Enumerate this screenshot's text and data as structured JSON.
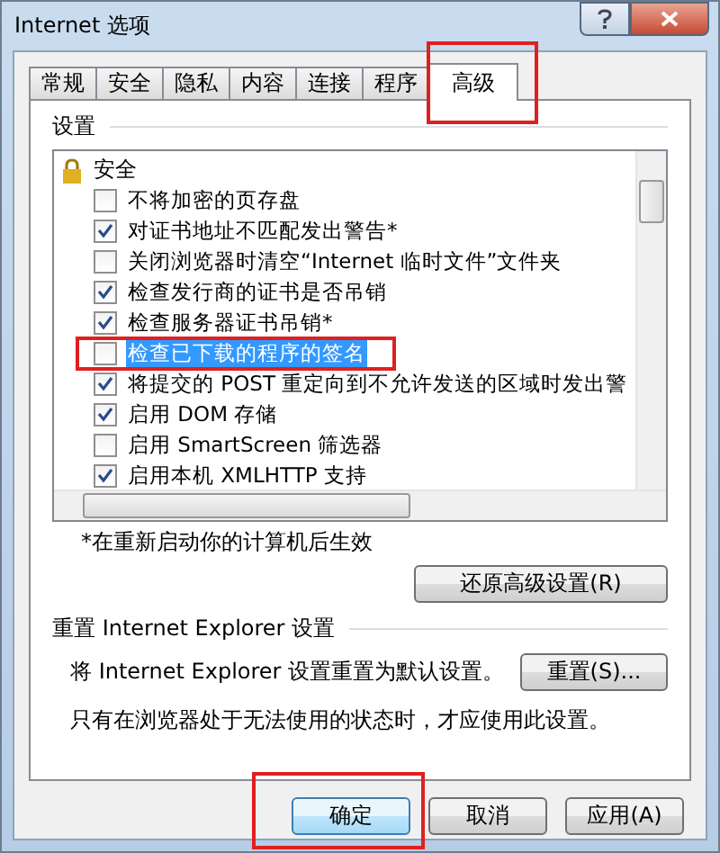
{
  "window": {
    "title": "Internet 选项"
  },
  "tabs": [
    {
      "label": "常规",
      "selected": false,
      "marked": false
    },
    {
      "label": "安全",
      "selected": false,
      "marked": false
    },
    {
      "label": "隐私",
      "selected": false,
      "marked": false
    },
    {
      "label": "内容",
      "selected": false,
      "marked": false
    },
    {
      "label": "连接",
      "selected": false,
      "marked": false
    },
    {
      "label": "程序",
      "selected": false,
      "marked": false
    },
    {
      "label": "高级",
      "selected": true,
      "marked": true
    }
  ],
  "settings": {
    "heading": "设置",
    "group": "安全",
    "items": [
      {
        "label": "不将加密的页存盘",
        "checked": false,
        "selected": false,
        "marked": false
      },
      {
        "label": "对证书地址不匹配发出警告*",
        "checked": true,
        "selected": false,
        "marked": false
      },
      {
        "label": "关闭浏览器时清空“Internet 临时文件”文件夹",
        "checked": false,
        "selected": false,
        "marked": false
      },
      {
        "label": "检查发行商的证书是否吊销",
        "checked": true,
        "selected": false,
        "marked": false
      },
      {
        "label": "检查服务器证书吊销*",
        "checked": true,
        "selected": false,
        "marked": false
      },
      {
        "label": "检查已下载的程序的签名",
        "checked": false,
        "selected": true,
        "marked": true
      },
      {
        "label": "将提交的 POST 重定向到不允许发送的区域时发出警",
        "checked": true,
        "selected": false,
        "marked": false
      },
      {
        "label": "启用 DOM 存储",
        "checked": true,
        "selected": false,
        "marked": false
      },
      {
        "label": "启用 SmartScreen 筛选器",
        "checked": false,
        "selected": false,
        "marked": false
      },
      {
        "label": "启用本机 XMLHTTP 支持",
        "checked": true,
        "selected": false,
        "marked": false
      }
    ],
    "note": "*在重新启动你的计算机后生效",
    "restore_button": "还原高级设置(R)"
  },
  "reset": {
    "heading": "重置 Internet Explorer 设置",
    "description": "将 Internet Explorer 设置重置为默认设置。",
    "button": "重置(S)...",
    "warning": "只有在浏览器处于无法使用的状态时，才应使用此设置。"
  },
  "buttons": [
    {
      "label": "确定",
      "marked": true
    },
    {
      "label": "取消",
      "marked": false
    },
    {
      "label": "应用(A)",
      "marked": false
    }
  ]
}
